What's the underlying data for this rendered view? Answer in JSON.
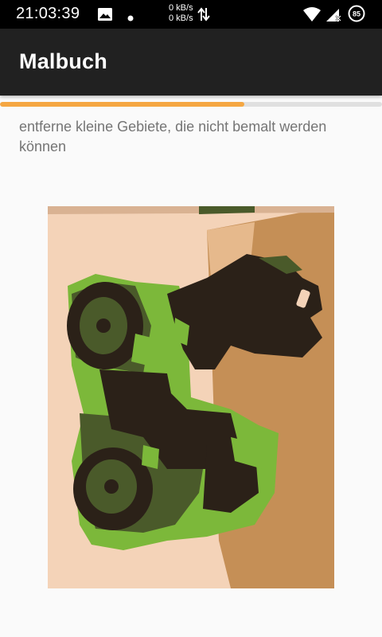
{
  "status_bar": {
    "time": "21:03:39",
    "speed_up": "0 kB/s",
    "speed_down": "0 kB/s",
    "battery": "85",
    "icons": [
      "image-icon",
      "dot-icon",
      "data-arrows-icon",
      "wifi-icon",
      "signal-icon",
      "battery-icon"
    ]
  },
  "app_bar": {
    "title": "Malbuch"
  },
  "progress": {
    "fraction": 0.64,
    "color": "#f5a742"
  },
  "instruction": "entferne kleine Gebiete, die nicht bemalt werden können",
  "colors": {
    "accent": "#f5a742",
    "app_bar": "#212121",
    "image_green": "#7cb83a",
    "image_dark": "#2b2118",
    "image_olive": "#4a5a2a",
    "image_skin": "#f4d3b8",
    "image_tan": "#c58f56"
  }
}
